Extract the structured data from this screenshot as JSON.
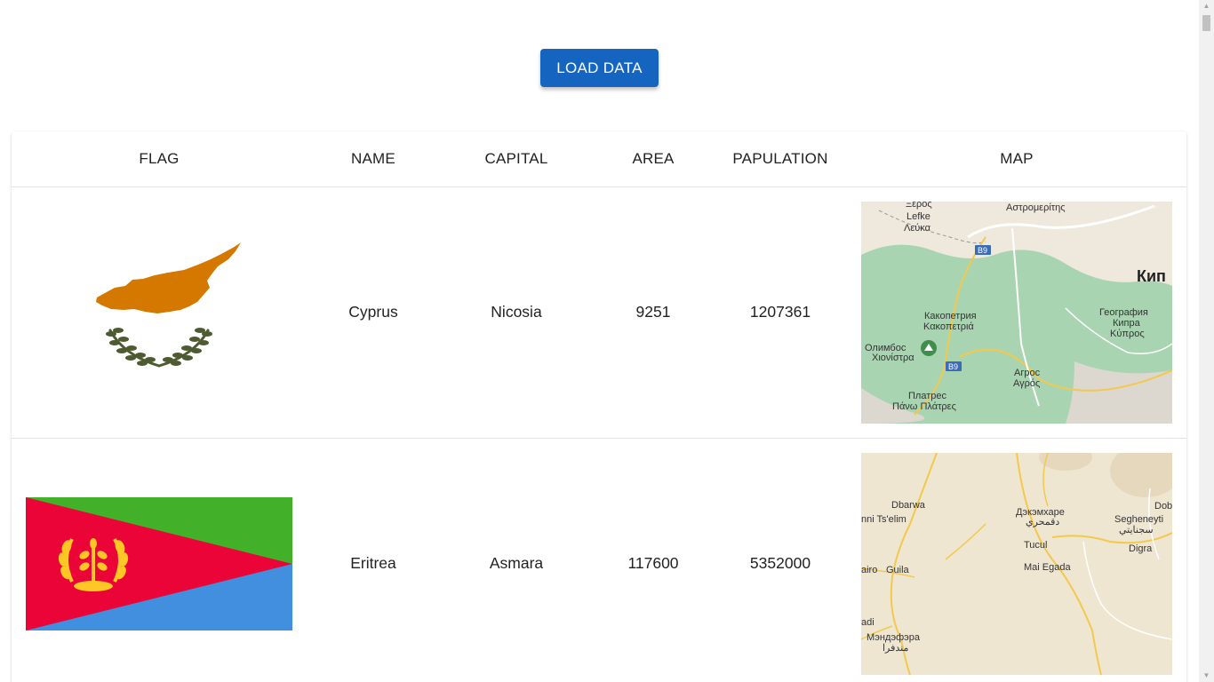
{
  "toolbar": {
    "load_button_label": "LOAD DATA"
  },
  "table": {
    "columns": [
      "FLAG",
      "NAME",
      "CAPITAL",
      "AREA",
      "PAPULATION",
      "MAP"
    ],
    "rows": [
      {
        "name": "Cyprus",
        "capital": "Nicosia",
        "area": "9251",
        "population": "1207361",
        "flag_icon": "cyprus-flag",
        "map_labels": {
          "l1": "Ξερος",
          "l2": "Lefke",
          "l3": "Λεύκα",
          "l4": "Αστρομερίτης",
          "l5": "Кип",
          "l6": "Какопетрия",
          "l7": "Κακοπετριά",
          "l8": "Олимбос",
          "l9": "Χιονίστρα",
          "l10": "География",
          "l11": "Кипра",
          "l12": "Κύπρος",
          "l13": "Агрос",
          "l14": "Αγρός",
          "l15": "Платрес",
          "l16": "Πάνω Πλάτρες",
          "r1": "B9",
          "r2": "B9"
        }
      },
      {
        "name": "Eritrea",
        "capital": "Asmara",
        "area": "117600",
        "population": "5352000",
        "flag_icon": "eritrea-flag",
        "map_labels": {
          "l1": "Dbarwa",
          "l2": "nni Ts'elim",
          "l3": "Дэкэмхаре",
          "l4": "دقمحري",
          "l5": "Tucul",
          "l6": "Mai Egada",
          "l7": "Guila",
          "l8": "airo",
          "l9": "adi",
          "l10": "Мэндэфэра",
          "l11": "مندفرا",
          "l12": "Dob",
          "l13": "Segheneyti",
          "l14": "سجنايتي",
          "l15": "Digra"
        }
      }
    ]
  },
  "colors": {
    "button_bg": "#1565c0",
    "cyprus_island": "#d57800",
    "cyprus_olive": "#4e5b31",
    "eritrea_green": "#43b02a",
    "eritrea_red": "#ea0437",
    "eritrea_blue": "#418fde",
    "eritrea_emblem": "#ffc726"
  }
}
